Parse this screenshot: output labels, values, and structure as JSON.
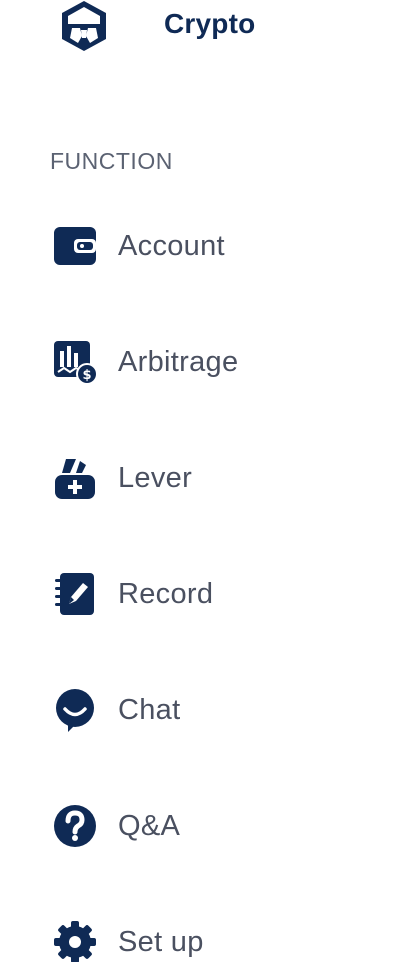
{
  "brand": {
    "name": "Crypto",
    "logo_icon": "crypto-shield-logo"
  },
  "colors": {
    "brand_navy": "#0f2a55",
    "text_gray": "#4a5060",
    "section_gray": "#5b6272",
    "background": "#ffffff"
  },
  "sidebar": {
    "section_title": "FUNCTION",
    "items": [
      {
        "label": "Account",
        "icon": "wallet-icon"
      },
      {
        "label": "Arbitrage",
        "icon": "chart-dollar-icon"
      },
      {
        "label": "Lever",
        "icon": "lever-plus-icon"
      },
      {
        "label": "Record",
        "icon": "notebook-pen-icon"
      },
      {
        "label": "Chat",
        "icon": "chat-smile-icon"
      },
      {
        "label": "Q&A",
        "icon": "question-icon"
      },
      {
        "label": "Set up",
        "icon": "gear-icon"
      }
    ]
  }
}
